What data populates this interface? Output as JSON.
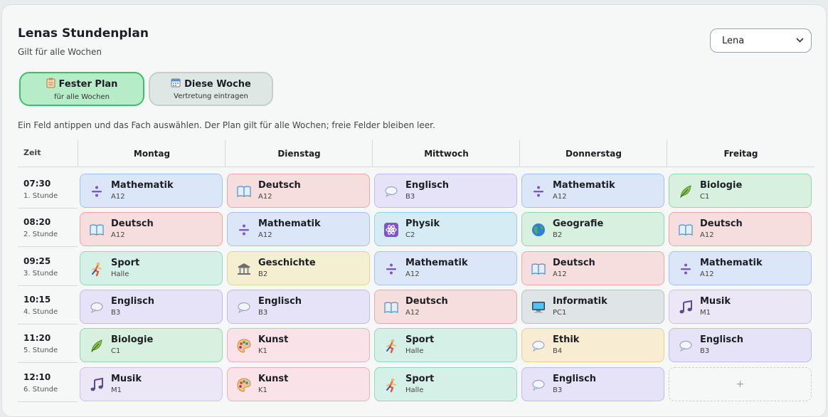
{
  "header": {
    "title": "Lenas Stundenplan",
    "subtitle": "Gilt für alle Wochen"
  },
  "student_select": {
    "value": "Lena"
  },
  "modes": [
    {
      "label": "Fester Plan",
      "sub": "für alle Wochen",
      "icon": "clipboard-icon",
      "active": true
    },
    {
      "label": "Diese Woche",
      "sub": "Vertretung eintragen",
      "icon": "calendar-icon",
      "active": false
    }
  ],
  "hint": "Ein Feld antippen und das Fach auswählen. Der Plan gilt für alle Wochen; freie Felder bleiben leer.",
  "time_header": "Zeit",
  "days": [
    "Montag",
    "Dienstag",
    "Mittwoch",
    "Donnerstag",
    "Freitag"
  ],
  "periods": [
    {
      "time": "07:30",
      "label": "1. Stunde"
    },
    {
      "time": "08:20",
      "label": "2. Stunde"
    },
    {
      "time": "09:25",
      "label": "3. Stunde"
    },
    {
      "time": "10:15",
      "label": "4. Stunde"
    },
    {
      "time": "11:20",
      "label": "5. Stunde"
    },
    {
      "time": "12:10",
      "label": "6. Stunde"
    }
  ],
  "empty_label": "+",
  "schedule": [
    [
      {
        "subject": "Mathematik",
        "room": "A12",
        "cls": "c-math",
        "icon": "math-icon"
      },
      {
        "subject": "Deutsch",
        "room": "A12",
        "cls": "c-deu",
        "icon": "book-icon"
      },
      {
        "subject": "Englisch",
        "room": "B3",
        "cls": "c-eng",
        "icon": "speech-bubble-icon"
      },
      {
        "subject": "Mathematik",
        "room": "A12",
        "cls": "c-math",
        "icon": "math-icon"
      },
      {
        "subject": "Biologie",
        "room": "C1",
        "cls": "c-bio",
        "icon": "leaf-icon"
      }
    ],
    [
      {
        "subject": "Deutsch",
        "room": "A12",
        "cls": "c-deu",
        "icon": "book-icon"
      },
      {
        "subject": "Mathematik",
        "room": "A12",
        "cls": "c-math",
        "icon": "math-icon"
      },
      {
        "subject": "Physik",
        "room": "C2",
        "cls": "c-phy",
        "icon": "atom-icon"
      },
      {
        "subject": "Geografie",
        "room": "B2",
        "cls": "c-geo",
        "icon": "globe-icon"
      },
      {
        "subject": "Deutsch",
        "room": "A12",
        "cls": "c-deu",
        "icon": "book-icon"
      }
    ],
    [
      {
        "subject": "Sport",
        "room": "Halle",
        "cls": "c-sport",
        "icon": "runner-icon"
      },
      {
        "subject": "Geschichte",
        "room": "B2",
        "cls": "c-gesch",
        "icon": "museum-icon"
      },
      {
        "subject": "Mathematik",
        "room": "A12",
        "cls": "c-math",
        "icon": "math-icon"
      },
      {
        "subject": "Deutsch",
        "room": "A12",
        "cls": "c-deu",
        "icon": "book-icon"
      },
      {
        "subject": "Mathematik",
        "room": "A12",
        "cls": "c-math",
        "icon": "math-icon"
      }
    ],
    [
      {
        "subject": "Englisch",
        "room": "B3",
        "cls": "c-eng",
        "icon": "speech-bubble-icon"
      },
      {
        "subject": "Englisch",
        "room": "B3",
        "cls": "c-eng",
        "icon": "speech-bubble-icon"
      },
      {
        "subject": "Deutsch",
        "room": "A12",
        "cls": "c-deu",
        "icon": "book-icon"
      },
      {
        "subject": "Informatik",
        "room": "PC1",
        "cls": "c-info",
        "icon": "computer-icon"
      },
      {
        "subject": "Musik",
        "room": "M1",
        "cls": "c-musik",
        "icon": "music-note-icon"
      }
    ],
    [
      {
        "subject": "Biologie",
        "room": "C1",
        "cls": "c-bio",
        "icon": "leaf-icon"
      },
      {
        "subject": "Kunst",
        "room": "K1",
        "cls": "c-kunst",
        "icon": "palette-icon"
      },
      {
        "subject": "Sport",
        "room": "Halle",
        "cls": "c-sport",
        "icon": "runner-icon"
      },
      {
        "subject": "Ethik",
        "room": "B4",
        "cls": "c-ethik",
        "icon": "speech-bubble-icon"
      },
      {
        "subject": "Englisch",
        "room": "B3",
        "cls": "c-eng",
        "icon": "speech-bubble-icon"
      }
    ],
    [
      {
        "subject": "Musik",
        "room": "M1",
        "cls": "c-musik",
        "icon": "music-note-icon"
      },
      {
        "subject": "Kunst",
        "room": "K1",
        "cls": "c-kunst",
        "icon": "palette-icon"
      },
      {
        "subject": "Sport",
        "room": "Halle",
        "cls": "c-sport",
        "icon": "runner-icon"
      },
      {
        "subject": "Englisch",
        "room": "B3",
        "cls": "c-eng",
        "icon": "speech-bubble-icon"
      },
      null
    ]
  ]
}
